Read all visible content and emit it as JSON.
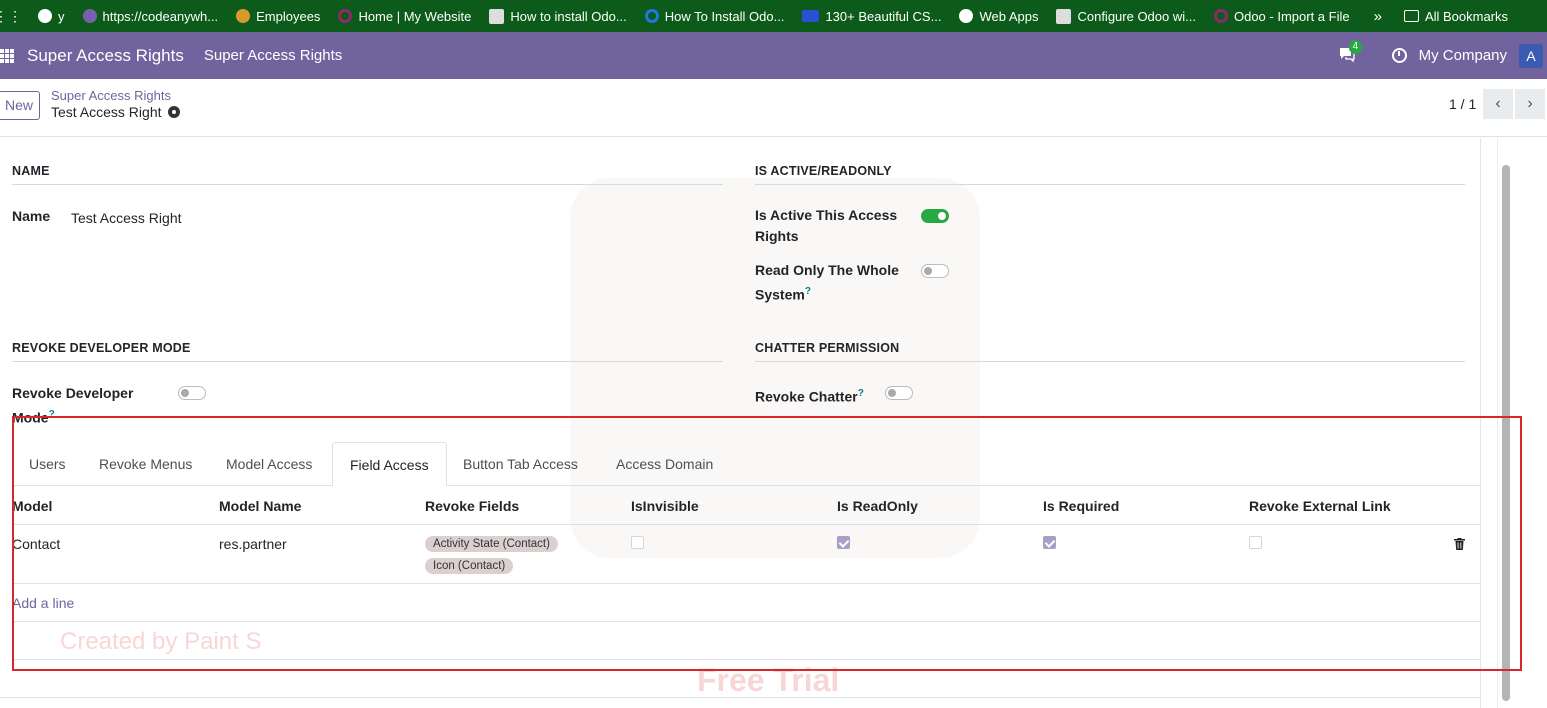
{
  "bookmarks": {
    "items": [
      {
        "label": "y",
        "icon": "globe-icon",
        "color": "#ffffff"
      },
      {
        "label": "https://codeanywh...",
        "icon": "codeanywhere-icon",
        "color": "#7a5fb0"
      },
      {
        "label": "Employees",
        "icon": "employees-icon",
        "color": "#d69b2b"
      },
      {
        "label": "Home | My Website",
        "icon": "odoo-icon",
        "color": "#8e2a6b"
      },
      {
        "label": "How to install Odo...",
        "icon": "doc-icon",
        "color": "#dddddd"
      },
      {
        "label": "How To Install Odo...",
        "icon": "blue-circle-icon",
        "color": "#1f7ae0"
      },
      {
        "label": "130+ Beautiful CS...",
        "icon": "dev-icon",
        "color": "#2a4ed6"
      },
      {
        "label": "Web Apps",
        "icon": "globe-icon",
        "color": "#ffffff"
      },
      {
        "label": "Configure Odoo wi...",
        "icon": "doc-icon",
        "color": "#dddddd"
      },
      {
        "label": "Odoo - Import a File",
        "icon": "odoo-icon",
        "color": "#8e2a6b"
      }
    ],
    "more": "»",
    "all_bookmarks": "All Bookmarks"
  },
  "navbar": {
    "brand": "Super Access Rights",
    "menu": "Super Access Rights",
    "chat_count": "4",
    "company": "My Company",
    "avatar": "A"
  },
  "control": {
    "new_button": "New",
    "breadcrumb_parent": "Super Access Rights",
    "breadcrumb_current": "Test Access Right",
    "pager": "1 / 1",
    "prev": "‹",
    "next": "›"
  },
  "form": {
    "section_name": "NAME",
    "name_label": "Name",
    "name_value": "Test Access Right",
    "section_active": "IS ACTIVE/READONLY",
    "active_label_1": "Is Active This Access",
    "active_label_2": "Rights",
    "active_value": true,
    "readonly_label_1": "Read Only The Whole",
    "readonly_label_2": "System",
    "readonly_value": false,
    "section_devmode": "REVOKE DEVELOPER MODE",
    "devmode_label_1": "Revoke Developer",
    "devmode_label_2": "Mode",
    "devmode_value": false,
    "section_chatter": "CHATTER PERMISSION",
    "chatter_label": "Revoke Chatter",
    "chatter_value": false,
    "help_mark": "?"
  },
  "tabs": [
    {
      "label": "Users",
      "active": false
    },
    {
      "label": "Revoke Menus",
      "active": false
    },
    {
      "label": "Model Access",
      "active": false
    },
    {
      "label": "Field Access",
      "active": true
    },
    {
      "label": "Button Tab Access",
      "active": false
    },
    {
      "label": "Access Domain",
      "active": false
    }
  ],
  "table": {
    "columns": [
      "Model",
      "Model Name",
      "Revoke Fields",
      "IsInvisible",
      "Is ReadOnly",
      "Is Required",
      "Revoke External Link"
    ],
    "rows": [
      {
        "model": "Contact",
        "model_name": "res.partner",
        "revoke_fields": [
          "Activity State (Contact)",
          "Icon (Contact)"
        ],
        "is_invisible": false,
        "is_readonly": true,
        "is_required": true,
        "revoke_external_link": false
      }
    ],
    "add_line": "Add a line"
  },
  "watermark": {
    "free_trial": "Free Trial",
    "created_by": "Created by Paint S"
  },
  "colors": {
    "bookmarks_bg": "#0c5b1a",
    "navbar_bg": "#71639e",
    "accent": "#71639e",
    "toggle_on": "#28a745",
    "highlight_box": "#d9262a"
  }
}
